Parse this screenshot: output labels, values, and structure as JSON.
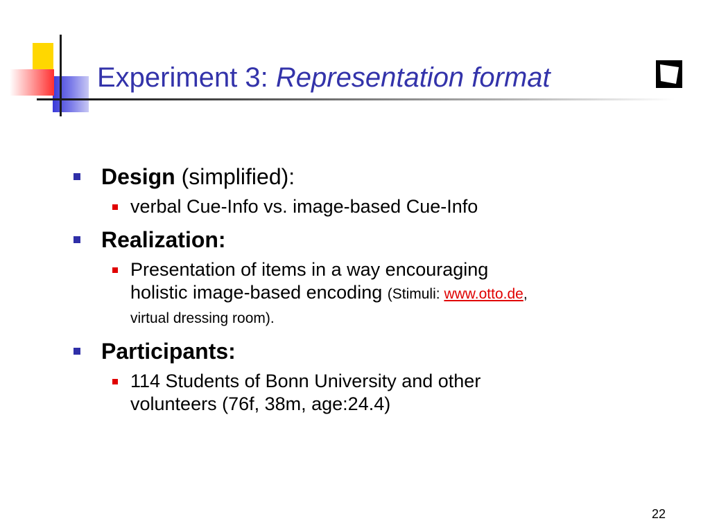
{
  "slide": {
    "title_main": "Experiment 3: ",
    "title_italic": "Representation format",
    "design": {
      "label": "Design",
      "suffix": " (simplified):",
      "sub": "verbal Cue-Info vs. image-based Cue-Info"
    },
    "realization": {
      "label": "Realization:",
      "sub_line1": "Presentation of items in a way encouraging",
      "sub_line2": "holistic image-based encoding",
      "stimuli_label": "(Stimuli: ",
      "stimuli_link": "www.otto.de",
      "stimuli_comma": ",",
      "stimuli_rest": "virtual dressing room)."
    },
    "participants": {
      "label": "Participants:",
      "sub_line1": "114 Students of Bonn University and other",
      "sub_line2": "volunteers (76f, 38m, age:24.4)"
    },
    "page_number": "22"
  },
  "colors": {
    "title": "#3333aa",
    "bullet_level1": "#2f2fa8",
    "bullet_level2": "#e00000",
    "link": "#e00000",
    "deco_yellow": "#ffd700",
    "deco_blue": "#3a3ad8",
    "deco_red": "#ff3030"
  },
  "icons": {
    "logo": "tilted-square-logo-icon",
    "bullet_level1": "square-bullet-icon",
    "bullet_level2": "small-square-bullet-icon"
  }
}
